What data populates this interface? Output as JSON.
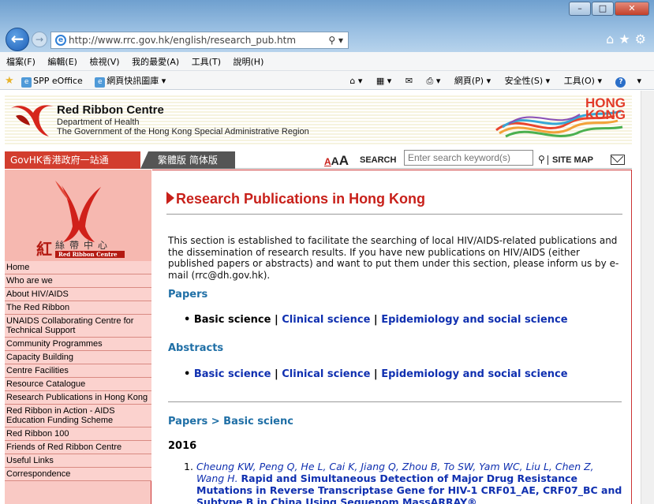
{
  "browser": {
    "url": "http://www.rrc.gov.hk/english/research_pub.htm",
    "search_icon": "search-icon",
    "menu": [
      "檔案(F)",
      "編輯(E)",
      "檢視(V)",
      "我的最愛(A)",
      "工具(T)",
      "說明(H)"
    ],
    "favorites": [
      "SPP eOffice",
      "網頁快訊圖庫 ▾"
    ],
    "commands": [
      "網頁(P) ▾",
      "安全性(S) ▾",
      "工具(O) ▾"
    ],
    "accent": "#2f6fb3"
  },
  "header": {
    "title": "Red Ribbon Centre",
    "sub1": "Department of Health",
    "sub2": "The Government of the Hong Kong Special Administrative Region",
    "hk_line1": "HONG",
    "hk_line2": "KONG"
  },
  "nav": {
    "govhk": "GovHK香港政府一站通",
    "lang": "繁體版  简体版",
    "font_small": "A",
    "font_mid": "A",
    "font_large": "A",
    "search_label": "SEARCH",
    "search_placeholder": "Enter search keyword(s)",
    "sitemap": "SITE MAP"
  },
  "sidebar": {
    "logo_cn": "紅絲帶中心",
    "logo_en": "Red Ribbon Centre",
    "items": [
      "Home",
      "Who are we",
      "About HIV/AIDS",
      "The Red Ribbon",
      "UNAIDS Collaborating Centre for Technical Support",
      "Community Programmes",
      "Capacity Building",
      "Centre Facilities",
      "Resource Catalogue",
      "Research Publications in Hong Kong",
      "Red Ribbon in Action - AIDS Education Funding Scheme",
      "Red Ribbon 100",
      "Friends of Red Ribbon Centre",
      "Useful Links",
      "Correspondence"
    ]
  },
  "main": {
    "title": "Research Publications in Hong Kong",
    "intro": "This section is established to facilitate the searching of local HIV/AIDS-related publications and the dissemination of research results. If you have new publications on HIV/AIDS (either published papers or abstracts) and want to put them under this section, please inform us by e-mail (rrc@dh.gov.hk).",
    "papers_heading": "Papers",
    "abstracts_heading": "Abstracts",
    "link_basic": "Basic science",
    "link_clinical": "Clinical science",
    "link_epi": "Epidemiology and social science",
    "sep": "|",
    "breadcrumb": "Papers > Basic scienc",
    "year": "2016",
    "ref_num": "1.",
    "ref_authors": "Cheung KW, Peng Q, He L, Cai K, Jiang Q, Zhou B, To SW, Yam WC, Liu L, Chen Z, Wang H.",
    "ref_title": "Rapid and Simultaneous Detection of Major Drug Resistance Mutations in Reverse Transcriptase Gene for HIV-1 CRF01_AE, CRF07_BC and Subtype B in China Using Sequenom MassARRAY®"
  }
}
